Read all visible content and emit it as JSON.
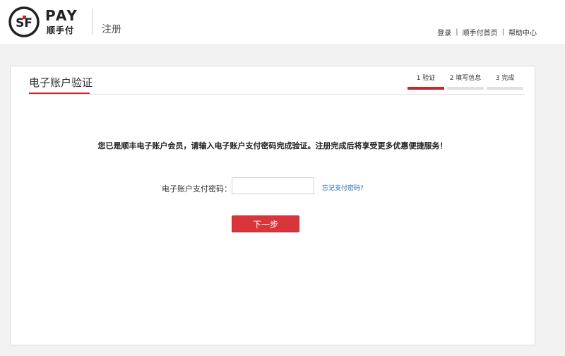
{
  "header": {
    "logo_mark": "SF",
    "logo_text": "PAY",
    "logo_subtext": "顺手付",
    "title": "注册",
    "links": [
      "登录",
      "顺手付首页",
      "帮助中心"
    ],
    "separator": "|"
  },
  "card": {
    "title": "电子账户验证",
    "steps": [
      {
        "label": "1 验证",
        "active": true
      },
      {
        "label": "2 填写信息",
        "active": false
      },
      {
        "label": "3 完成",
        "active": false
      }
    ],
    "notice": "您已是顺丰电子账户会员，请输入电子账户支付密码完成验证。注册完成后将享受更多优惠便捷服务！",
    "password_label": "电子账户支付密码：",
    "password_value": "",
    "forgot_link": "忘记支付密码?",
    "next_button": "下一步"
  },
  "colors": {
    "accent": "#c9262c",
    "button": "#d9353a",
    "link": "#2f6fb7"
  }
}
